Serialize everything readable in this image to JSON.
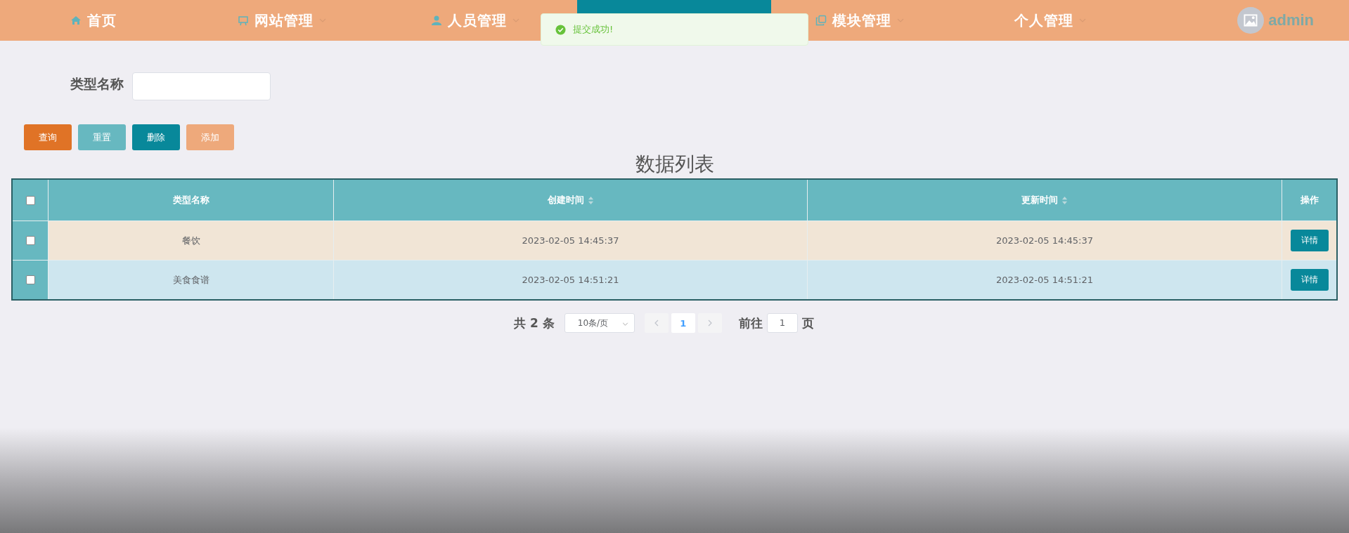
{
  "nav": {
    "items": [
      {
        "label": "首页",
        "dropdown": false
      },
      {
        "label": "网站管理",
        "dropdown": true
      },
      {
        "label": "人员管理",
        "dropdown": true
      },
      {
        "label": "模块管理",
        "dropdown": true
      },
      {
        "label": "个人管理",
        "dropdown": true
      }
    ],
    "user": "admin"
  },
  "toast": {
    "message": "提交成功!"
  },
  "search": {
    "label": "类型名称"
  },
  "buttons": [
    {
      "label": "查询",
      "color": "#e07326"
    },
    {
      "label": "重置",
      "color": "#67b8c0"
    },
    {
      "label": "删除",
      "color": "#08889a"
    },
    {
      "label": "添加",
      "color": "#eea97b"
    }
  ],
  "table": {
    "title": "数据列表",
    "all_checked": false,
    "columns": [
      {
        "label": "类型名称",
        "sortable": false
      },
      {
        "label": "创建时间",
        "sortable": true
      },
      {
        "label": "更新时间",
        "sortable": true
      },
      {
        "label": "操作",
        "sortable": false
      }
    ],
    "rows": [
      {
        "checked": false,
        "cells": [
          "餐饮",
          "2023-02-05 14:45:37",
          "2023-02-05 14:45:37"
        ],
        "action": "详情"
      },
      {
        "checked": false,
        "cells": [
          "美食食谱",
          "2023-02-05 14:51:21",
          "2023-02-05 14:51:21"
        ],
        "action": "详情"
      }
    ]
  },
  "pagination": {
    "total": "共 2 条",
    "page_size": "10条/页",
    "pages": [
      {
        "label": "1",
        "selected": true
      }
    ],
    "goto_label": "前往",
    "goto_value": "1",
    "page_suffix": "页"
  }
}
